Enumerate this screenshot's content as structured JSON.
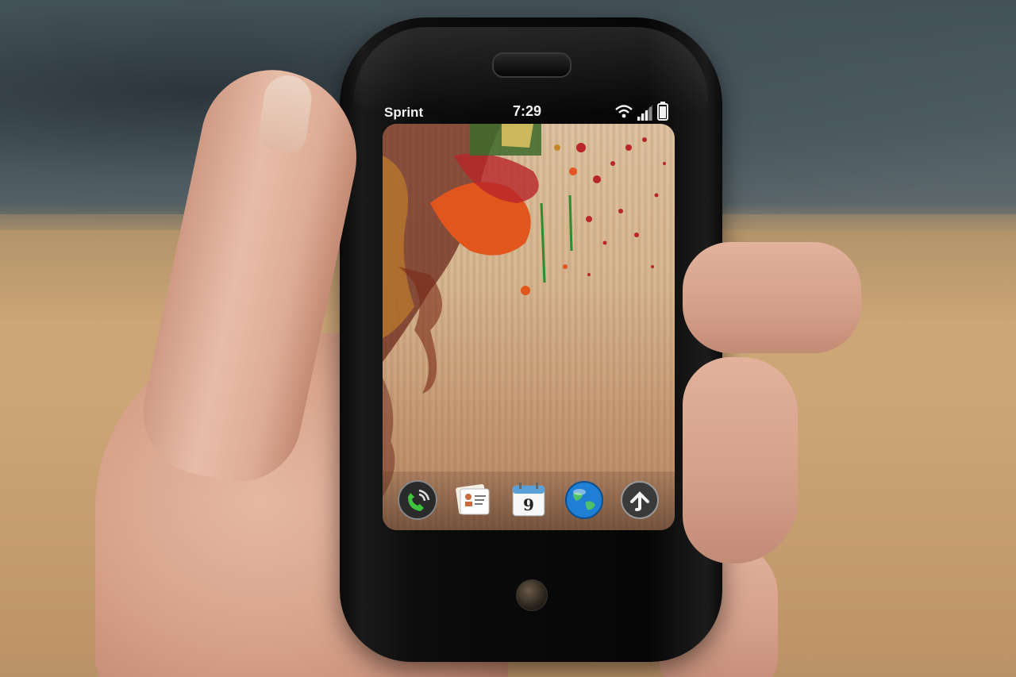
{
  "status_bar": {
    "carrier": "Sprint",
    "time": "7:29",
    "wifi_icon": "wifi-icon",
    "signal_icon": "signal-bars-icon",
    "battery_icon": "battery-icon"
  },
  "dock": {
    "apps": [
      {
        "icon": "phone-icon"
      },
      {
        "icon": "contacts-icon"
      },
      {
        "icon": "calendar-icon",
        "day": "9"
      },
      {
        "icon": "globe-icon"
      },
      {
        "icon": "launcher-up-arrow-icon"
      }
    ]
  },
  "colors": {
    "phone_body": "#0a0a0a",
    "status_text": "#f2f2f2",
    "paint_orange": "#e0561c",
    "paint_red": "#b8262a",
    "paint_maroon": "#6b2a1c",
    "paint_green": "#2e8b2e",
    "wood": "#d9b992"
  }
}
